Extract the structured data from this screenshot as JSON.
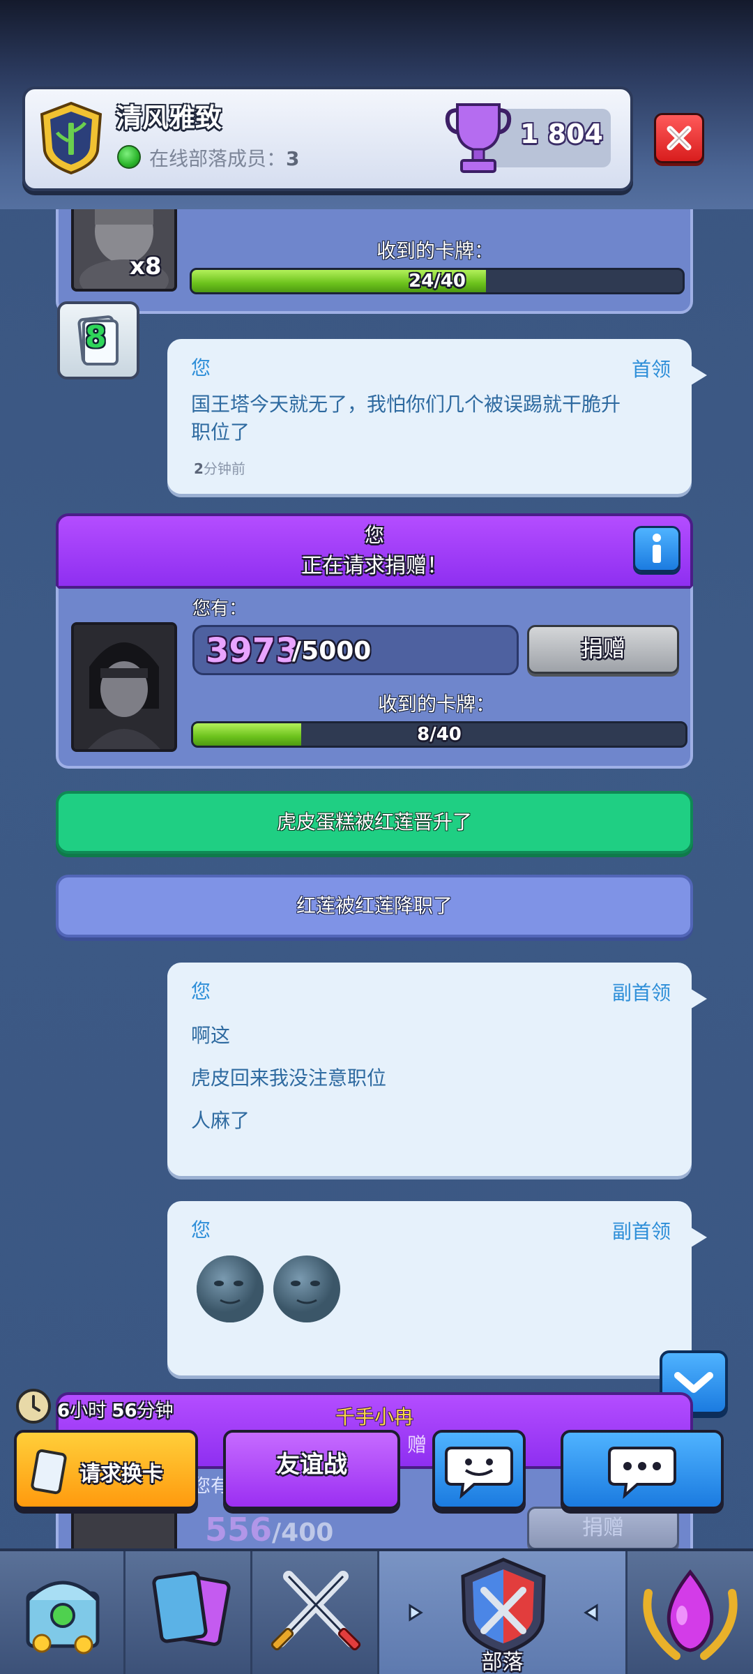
{
  "header": {
    "clan_name": "清风雅致",
    "online_label": "在线部落成员：",
    "online_count": "3",
    "trophies": "1 804"
  },
  "top_request": {
    "card_count": "x8",
    "received_label": "收到的卡牌：",
    "progress_text": "24/40",
    "progress_fraction": 0.6,
    "level": "8"
  },
  "messages": [
    {
      "sender": "您",
      "role": "首领",
      "lines": [
        "国王塔今天就无了，我怕你们几个被误踢就干脆升",
        "职位了"
      ],
      "time_num": "2",
      "time_unit": "分钟前"
    },
    {
      "sender": "您",
      "role": "副首领",
      "lines": [
        "啊这",
        "虎皮回来我没注意职位",
        "人麻了"
      ]
    },
    {
      "sender": "您",
      "role": "副首领",
      "emoji": [
        "🌚",
        "🌚"
      ]
    }
  ],
  "request": {
    "who": "您",
    "title": "正在请求捐赠！",
    "you_have_label": "您有：",
    "have": "3973",
    "need": "/5000",
    "donate_label": "捐赠",
    "received_label": "收到的卡牌：",
    "progress_text": "8/40",
    "progress_fraction": 0.2
  },
  "banners": [
    {
      "text": "虎皮蛋糕被红莲晋升了",
      "color": "#1fcf83"
    },
    {
      "text": "红莲被红莲降职了",
      "color": "#7f93e6"
    }
  ],
  "bottom_request": {
    "name": "千手小冉",
    "timer_h": "6",
    "timer_h_unit": "小时",
    "timer_m": "56",
    "timer_m_unit": "分钟",
    "partial_text": "赠",
    "you_have_partial": "您有",
    "have": "556",
    "need": "/400",
    "donate_label": "捐赠"
  },
  "actions": {
    "request_card": "请求换卡",
    "friendly_battle": "友谊战"
  },
  "nav": {
    "active_label": "部落"
  },
  "colors": {
    "accent_blue": "#2d8ed8",
    "purple": "#9b3cf5",
    "green_banner": "#1fcf83",
    "gold_button": "#ffb61e"
  }
}
